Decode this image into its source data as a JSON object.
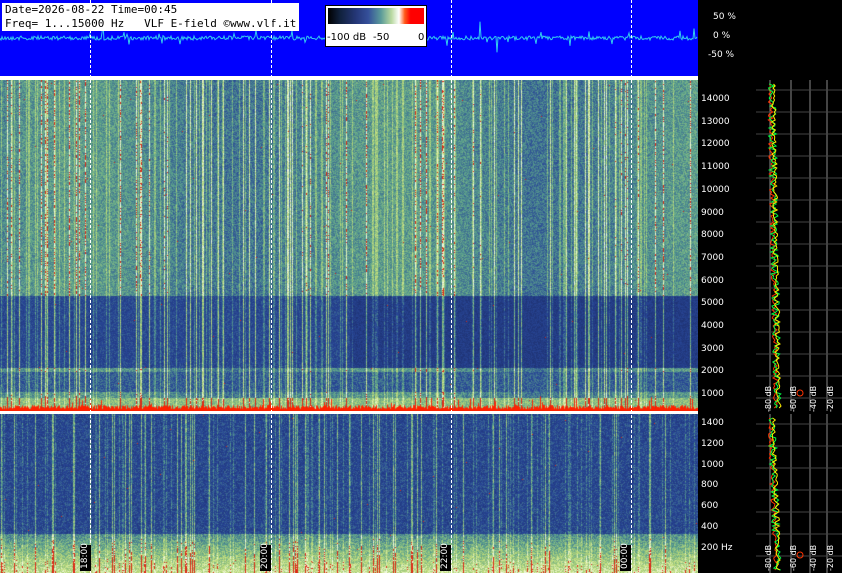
{
  "info": {
    "line1": "Date=2026-08-22 Time=00:45",
    "line2": "Freq= 1...15000 Hz   VLF E-field ©www.vlf.it"
  },
  "colorbar": {
    "min_label": "-100 dB",
    "mid_label": "-50",
    "max_label": "0"
  },
  "waveform_scale": [
    "50 %",
    "0 %",
    "-50 %"
  ],
  "freq_axis_upper": [
    "14000",
    "13000",
    "12000",
    "11000",
    "10000",
    "9000",
    "8000",
    "7000",
    "6000",
    "5000",
    "4000",
    "3000",
    "2000",
    "1000"
  ],
  "freq_axis_lower": [
    "1400",
    "1200",
    "1000",
    "800",
    "600",
    "400",
    "200 Hz"
  ],
  "db_labels_upper": [
    "-80 dB",
    "-60 dB",
    "-40 dB",
    "-20 dB"
  ],
  "db_labels_lower": [
    "-80 dB",
    "-60 dB",
    "-40 dB",
    "-20 dB"
  ],
  "time_labels": [
    "18:00",
    "20:00",
    "22:00",
    "00:00"
  ],
  "colors": {
    "waveform_bg": "#0000ff",
    "waveform_trace": "#33ccee",
    "profile_yellow": "#ffee00",
    "profile_green": "#00ff44",
    "profile_red": "#ff3300"
  },
  "icons": {
    "marker_circle": "red-circle-marker-icon"
  }
}
